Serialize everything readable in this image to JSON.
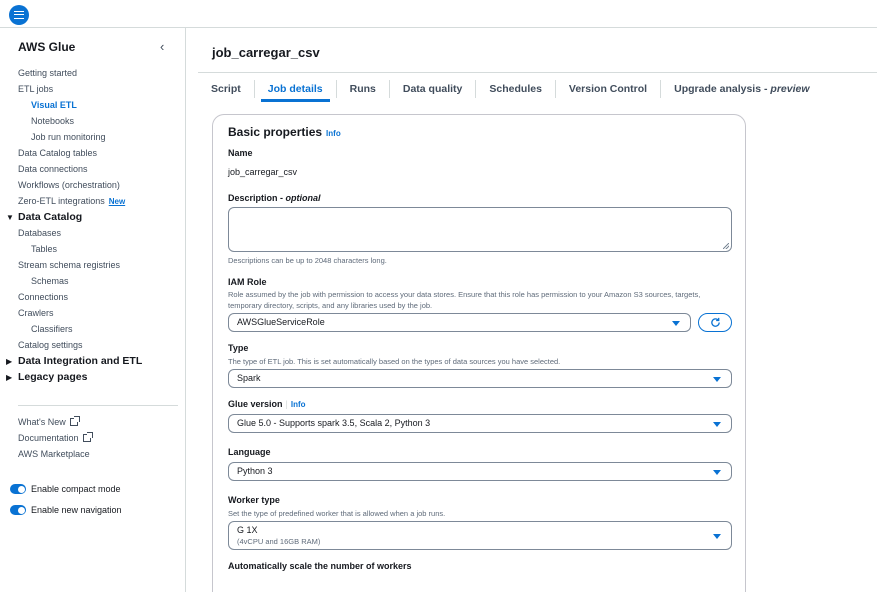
{
  "sidebar": {
    "title": "AWS Glue",
    "nav": [
      {
        "kind": "item",
        "level": 0,
        "label": "Getting started"
      },
      {
        "kind": "item",
        "level": 0,
        "label": "ETL jobs"
      },
      {
        "kind": "item",
        "level": 1,
        "label": "Visual ETL",
        "active": true
      },
      {
        "kind": "item",
        "level": 1,
        "label": "Notebooks"
      },
      {
        "kind": "item",
        "level": 1,
        "label": "Job run monitoring"
      },
      {
        "kind": "item",
        "level": 0,
        "label": "Data Catalog tables"
      },
      {
        "kind": "item",
        "level": 0,
        "label": "Data connections"
      },
      {
        "kind": "item",
        "level": 0,
        "label": "Workflows (orchestration)"
      },
      {
        "kind": "item",
        "level": 0,
        "label": "Zero-ETL integrations",
        "badge": "New"
      },
      {
        "kind": "section",
        "label": "Data Catalog",
        "expanded": true
      },
      {
        "kind": "item",
        "level": 0,
        "label": "Databases"
      },
      {
        "kind": "item",
        "level": 1,
        "label": "Tables"
      },
      {
        "kind": "item",
        "level": 0,
        "label": "Stream schema registries"
      },
      {
        "kind": "item",
        "level": 1,
        "label": "Schemas"
      },
      {
        "kind": "item",
        "level": 0,
        "label": "Connections"
      },
      {
        "kind": "item",
        "level": 0,
        "label": "Crawlers"
      },
      {
        "kind": "item",
        "level": 1,
        "label": "Classifiers"
      },
      {
        "kind": "item",
        "level": 0,
        "label": "Catalog settings"
      },
      {
        "kind": "section",
        "label": "Data Integration and ETL",
        "expanded": false
      },
      {
        "kind": "section",
        "label": "Legacy pages",
        "expanded": false
      }
    ],
    "links": [
      "What's New",
      "Documentation",
      "AWS Marketplace"
    ],
    "toggles": {
      "compact": "Enable compact mode",
      "navigation": "Enable new navigation"
    }
  },
  "main": {
    "title": "job_carregar_csv",
    "tabs": [
      {
        "label": "Script"
      },
      {
        "label": "Job details",
        "active": true
      },
      {
        "label": "Runs"
      },
      {
        "label": "Data quality"
      },
      {
        "label": "Schedules"
      },
      {
        "label": "Version Control"
      },
      {
        "label": "Upgrade analysis - ",
        "suffix": "preview"
      }
    ]
  },
  "basic": {
    "heading": "Basic properties",
    "info": "Info",
    "name_label": "Name",
    "name_value": "job_carregar_csv",
    "description_label": "Description - ",
    "description_optional": "optional",
    "description_value": "",
    "description_hint": "Descriptions can be up to 2048 characters long.",
    "iam_label": "IAM Role",
    "iam_desc": "Role assumed by the job with permission to access your data stores. Ensure that this role has permission to your Amazon S3 sources, targets, temporary directory, scripts, and any libraries used by the job.",
    "iam_value": "AWSGlueServiceRole",
    "type_label": "Type",
    "type_desc": "The type of ETL job. This is set automatically based on the types of data sources you have selected.",
    "type_value": "Spark",
    "glue_label": "Glue version",
    "glue_info": "Info",
    "glue_value": "Glue 5.0 - Supports spark 3.5, Scala 2, Python 3",
    "language_label": "Language",
    "language_value": "Python 3",
    "worker_label": "Worker type",
    "worker_desc": "Set the type of predefined worker that is allowed when a job runs.",
    "worker_value": "G 1X",
    "worker_sub": "(4vCPU and 16GB RAM)",
    "autoscale_label": "Automatically scale the number of workers"
  },
  "colors": {
    "accent": "#0972d3",
    "border": "#7d8998",
    "text": "#16191f",
    "muted": "#5f6b7a"
  }
}
